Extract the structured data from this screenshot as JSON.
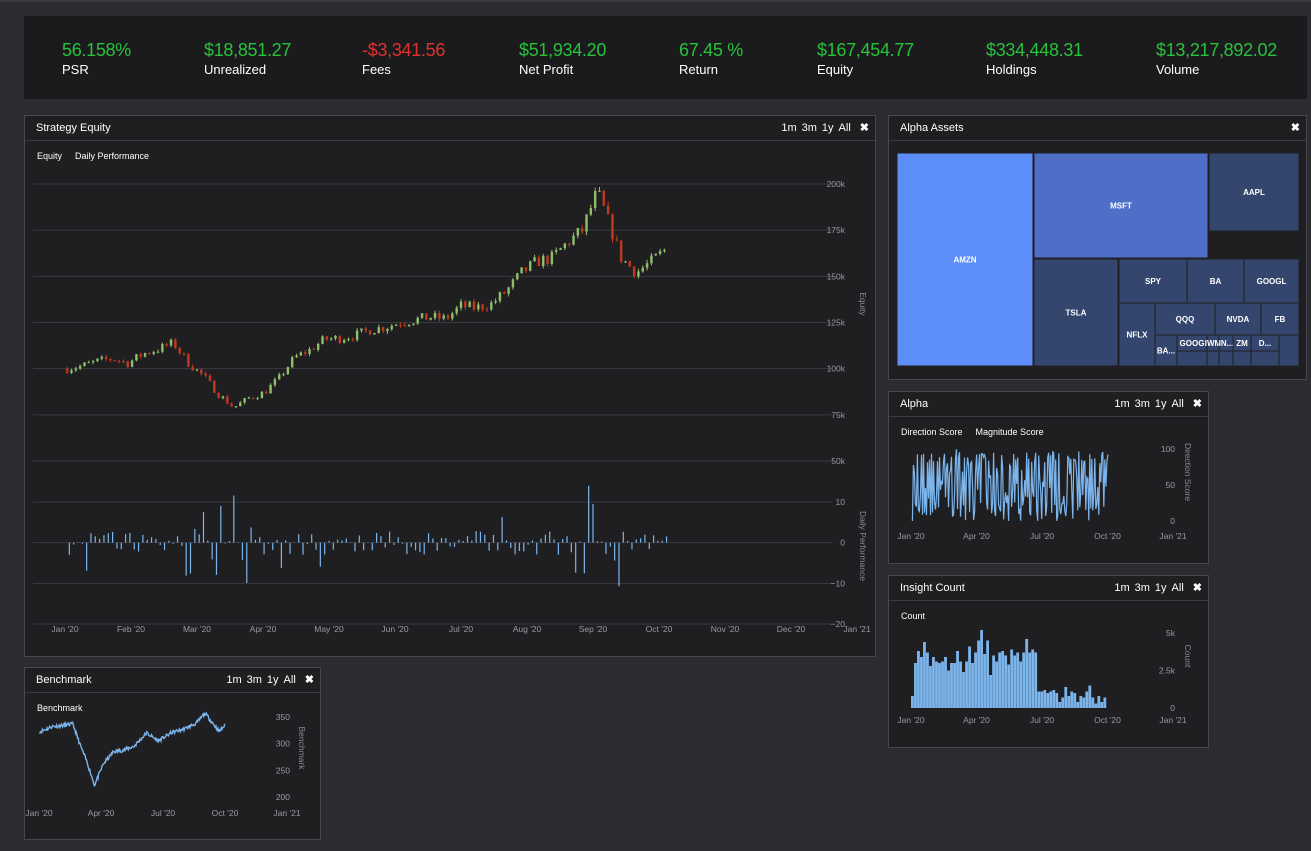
{
  "stats": [
    {
      "value": "56.158%",
      "label": "PSR",
      "color": "green"
    },
    {
      "value": "$18,851.27",
      "label": "Unrealized",
      "color": "green"
    },
    {
      "value": "-$3,341.56",
      "label": "Fees",
      "color": "red"
    },
    {
      "value": "$51,934.20",
      "label": "Net Profit",
      "color": "green"
    },
    {
      "value": "67.45 %",
      "label": "Return",
      "color": "green"
    },
    {
      "value": "$167,454.77",
      "label": "Equity",
      "color": "green"
    },
    {
      "value": "$334,448.31",
      "label": "Holdings",
      "color": "green"
    },
    {
      "value": "$13,217,892.02",
      "label": "Volume",
      "color": "green"
    }
  ],
  "controls": {
    "b1m": "1m",
    "b3m": "3m",
    "b1y": "1y",
    "ball": "All",
    "close": "✖"
  },
  "panels": {
    "equity": {
      "title": "Strategy Equity",
      "legend1": "Equity",
      "legend2": "Daily Performance"
    },
    "benchmark": {
      "title": "Benchmark",
      "legend1": "Benchmark"
    },
    "assets": {
      "title": "Alpha Assets"
    },
    "alpha": {
      "title": "Alpha",
      "legend1": "Direction Score",
      "legend2": "Magnitude Score"
    },
    "insight": {
      "title": "Insight Count",
      "legend1": "Count"
    }
  },
  "colors": {
    "up": "#8fbf6a",
    "down": "#c0391f",
    "line": "#7cb5ec",
    "treemap_primary": "#5d8ef7",
    "treemap_mid": "#4e6ec7",
    "treemap_dark": "#34466e"
  },
  "chart_data": [
    {
      "type": "candlestick",
      "name": "Strategy Equity",
      "ylabel": "Equity",
      "yticks": [
        "200k",
        "175k",
        "150k",
        "125k",
        "100k",
        "75k",
        "50k"
      ],
      "ylim": [
        50000,
        210000
      ],
      "xticks": [
        "Jan '20",
        "Feb '20",
        "Mar '20",
        "Apr '20",
        "May '20",
        "Jun '20",
        "Jul '20",
        "Aug '20",
        "Sep '20",
        "Oct '20",
        "Nov '20",
        "Dec '20",
        "Jan '21"
      ],
      "x_range": [
        "2020-01-01",
        "2021-01-01"
      ],
      "close_series": [
        [
          "2020-01-02",
          100000
        ],
        [
          "2020-01-09",
          101500
        ],
        [
          "2020-01-16",
          104000
        ],
        [
          "2020-01-23",
          105500
        ],
        [
          "2020-01-30",
          103000
        ],
        [
          "2020-02-06",
          108000
        ],
        [
          "2020-02-13",
          110500
        ],
        [
          "2020-02-20",
          114000
        ],
        [
          "2020-02-27",
          103000
        ],
        [
          "2020-03-05",
          96000
        ],
        [
          "2020-03-12",
          86000
        ],
        [
          "2020-03-19",
          79000
        ],
        [
          "2020-03-26",
          84000
        ],
        [
          "2020-04-02",
          87000
        ],
        [
          "2020-04-09",
          95000
        ],
        [
          "2020-04-16",
          106000
        ],
        [
          "2020-04-23",
          110000
        ],
        [
          "2020-04-30",
          116000
        ],
        [
          "2020-05-07",
          116500
        ],
        [
          "2020-05-14",
          118000
        ],
        [
          "2020-05-21",
          121000
        ],
        [
          "2020-05-28",
          122500
        ],
        [
          "2020-06-04",
          125000
        ],
        [
          "2020-06-11",
          126500
        ],
        [
          "2020-06-18",
          128000
        ],
        [
          "2020-06-25",
          127000
        ],
        [
          "2020-07-02",
          134000
        ],
        [
          "2020-07-09",
          133000
        ],
        [
          "2020-07-16",
          135000
        ],
        [
          "2020-07-23",
          142000
        ],
        [
          "2020-07-30",
          152000
        ],
        [
          "2020-08-06",
          158000
        ],
        [
          "2020-08-13",
          160000
        ],
        [
          "2020-08-20",
          168000
        ],
        [
          "2020-08-27",
          175000
        ],
        [
          "2020-09-03",
          196000
        ],
        [
          "2020-09-08",
          180000
        ],
        [
          "2020-09-14",
          160000
        ],
        [
          "2020-09-21",
          152000
        ],
        [
          "2020-09-28",
          158000
        ],
        [
          "2020-10-05",
          165000
        ]
      ]
    },
    {
      "type": "bar",
      "name": "Daily Performance",
      "ylabel": "Daily Performance",
      "yticks": [
        "10",
        "0",
        "−10",
        "−20"
      ],
      "ylim": [
        -20,
        12
      ]
    },
    {
      "type": "line",
      "name": "Benchmark",
      "ylabel": "Benchmark",
      "yticks": [
        "350",
        "300",
        "250",
        "200"
      ],
      "ylim": [
        195,
        355
      ],
      "xticks": [
        "Jan '20",
        "Apr '20",
        "Jul '20",
        "Oct '20",
        "Jan '21"
      ],
      "x_range": [
        "2020-01-01",
        "2021-01-01"
      ],
      "series": [
        [
          "2020-01-02",
          322
        ],
        [
          "2020-01-20",
          332
        ],
        [
          "2020-02-10",
          335
        ],
        [
          "2020-02-20",
          337
        ],
        [
          "2020-03-01",
          300
        ],
        [
          "2020-03-12",
          265
        ],
        [
          "2020-03-23",
          222
        ],
        [
          "2020-04-05",
          262
        ],
        [
          "2020-04-20",
          285
        ],
        [
          "2020-05-05",
          288
        ],
        [
          "2020-05-20",
          295
        ],
        [
          "2020-06-08",
          320
        ],
        [
          "2020-06-25",
          305
        ],
        [
          "2020-07-15",
          321
        ],
        [
          "2020-08-01",
          327
        ],
        [
          "2020-08-20",
          338
        ],
        [
          "2020-09-02",
          357
        ],
        [
          "2020-09-23",
          323
        ],
        [
          "2020-10-01",
          334
        ]
      ]
    },
    {
      "type": "treemap",
      "name": "Alpha Assets",
      "items": [
        {
          "label": "AMZN",
          "shade": "primary"
        },
        {
          "label": "MSFT",
          "shade": "mid"
        },
        {
          "label": "AAPL",
          "shade": "dark"
        },
        {
          "label": "TSLA",
          "shade": "dark"
        },
        {
          "label": "SPY",
          "shade": "dark"
        },
        {
          "label": "BA",
          "shade": "dark"
        },
        {
          "label": "GOOGL",
          "shade": "dark"
        },
        {
          "label": "NFLX",
          "shade": "dark"
        },
        {
          "label": "QQQ",
          "shade": "dark"
        },
        {
          "label": "NVDA",
          "shade": "dark"
        },
        {
          "label": "FB",
          "shade": "dark"
        },
        {
          "label": "BA...",
          "shade": "dark"
        },
        {
          "label": "GOOG",
          "shade": "dark"
        },
        {
          "label": "IWM",
          "shade": "dark"
        },
        {
          "label": "IN...",
          "shade": "dark"
        },
        {
          "label": "ZM",
          "shade": "dark"
        },
        {
          "label": "D...",
          "shade": "dark"
        }
      ]
    },
    {
      "type": "line",
      "name": "Alpha",
      "ylabel": "Direction Score",
      "yticks": [
        "100",
        "50",
        "0"
      ],
      "ylim": [
        0,
        100
      ],
      "xticks": [
        "Jan '20",
        "Apr '20",
        "Jul '20",
        "Oct '20",
        "Jan '21"
      ],
      "x_range": [
        "2020-01-01",
        "2021-01-01"
      ]
    },
    {
      "type": "bar",
      "name": "Insight Count",
      "ylabel": "Count",
      "yticks": [
        "5k",
        "2.5k",
        "0"
      ],
      "ylim": [
        0,
        5000
      ],
      "xticks": [
        "Jan '20",
        "Apr '20",
        "Jul '20",
        "Oct '20",
        "Jan '21"
      ],
      "x_range": [
        "2020-01-01",
        "2021-01-01"
      ],
      "values": [
        800,
        3000,
        3800,
        3400,
        4400,
        3700,
        2800,
        3400,
        3100,
        3000,
        3100,
        3400,
        2500,
        3000,
        3000,
        3800,
        3100,
        2400,
        3100,
        4100,
        3000,
        3700,
        4500,
        5200,
        3600,
        4500,
        2200,
        3500,
        3100,
        3700,
        3800,
        3500,
        2900,
        3900,
        3500,
        3700,
        3100,
        3700,
        4600,
        3700,
        3900,
        3700,
        1100,
        1100,
        1200,
        1000,
        1100,
        1200,
        1000,
        400,
        700,
        1400,
        800,
        1100,
        1000,
        400,
        800,
        700,
        1100,
        1500,
        700,
        300,
        800,
        400,
        700
      ]
    }
  ]
}
